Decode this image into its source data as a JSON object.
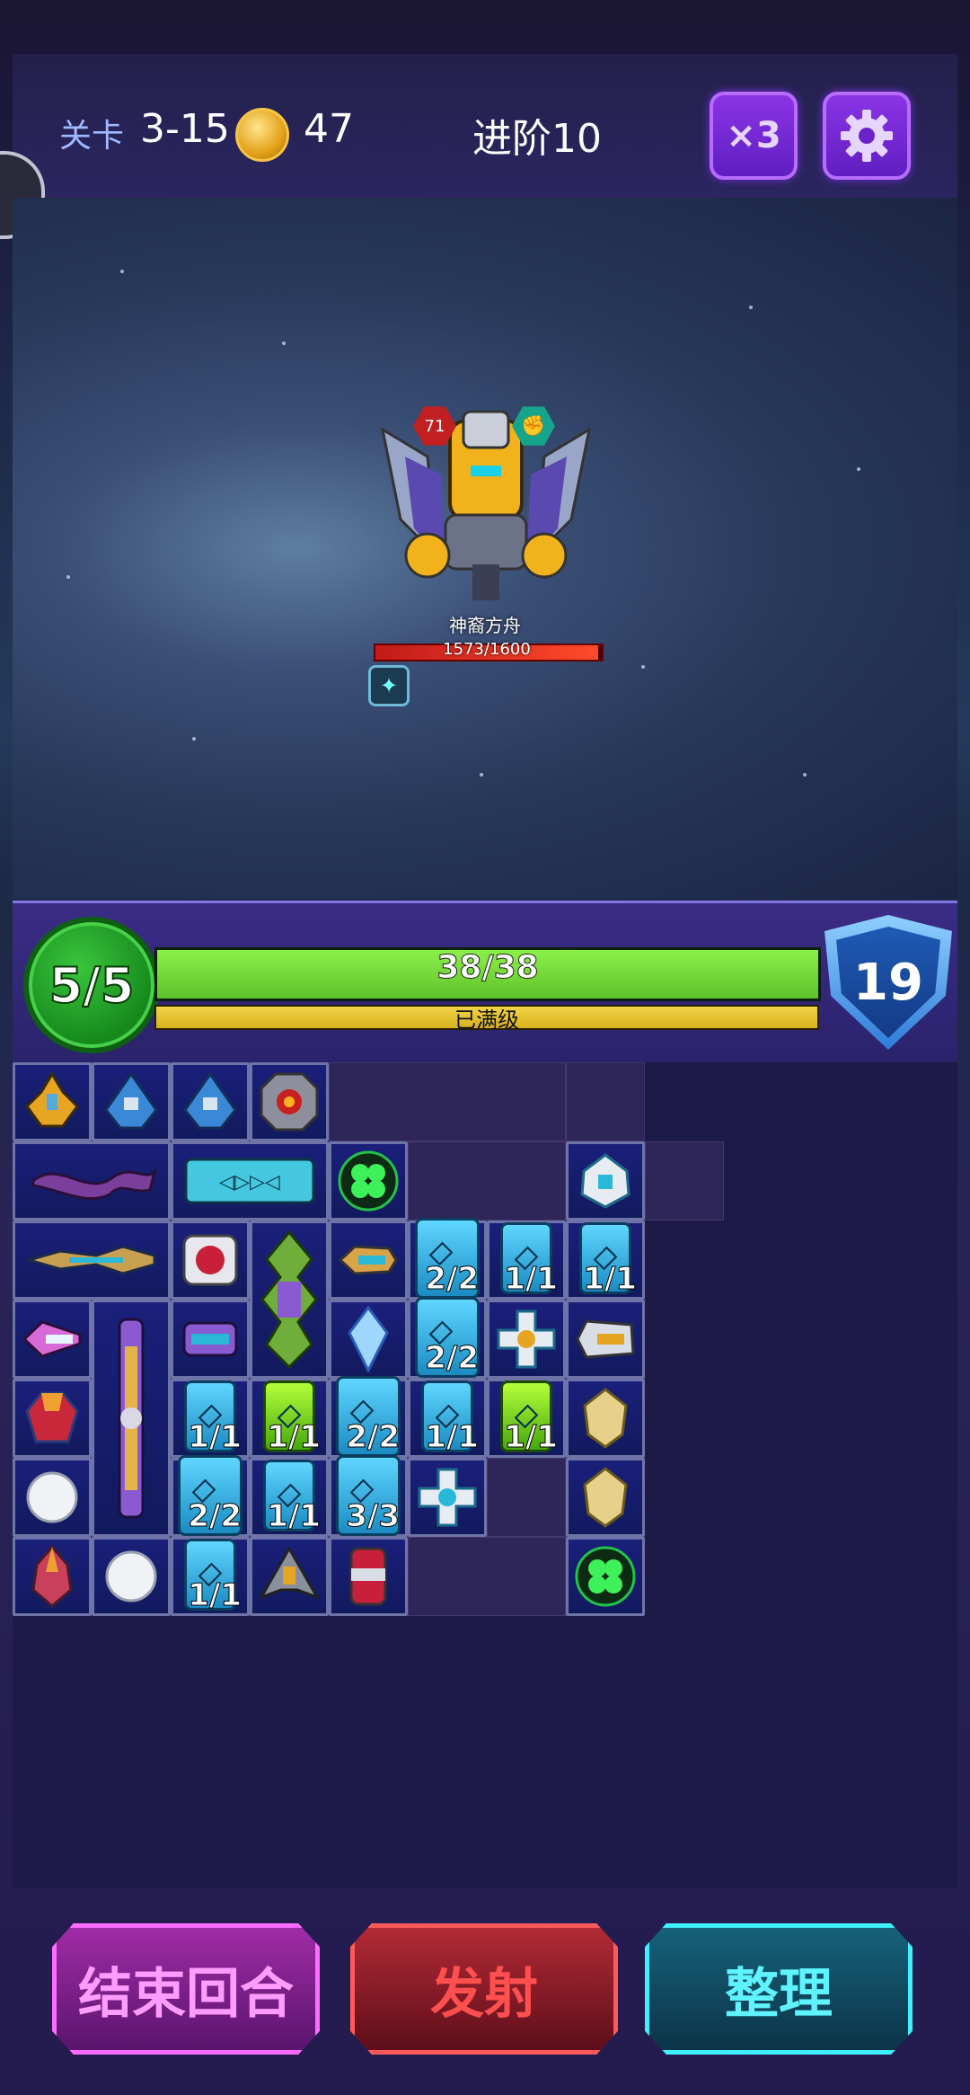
{
  "top_bar": {
    "stage_label": "关卡",
    "stage_value": "3-15",
    "coins": "47",
    "advance": "进阶10",
    "speed": "×3"
  },
  "boss": {
    "name": "神裔方舟",
    "level": "71",
    "hp_text": "1573/1600",
    "hp_fraction": 0.983
  },
  "player": {
    "energy": "5/5",
    "hp_text": "38/38",
    "hp_fraction": 1.0,
    "exp_text": "已满级",
    "exp_fraction": 1.0,
    "shield": "19"
  },
  "inventory": {
    "counts": {
      "c1": "2/2",
      "c2": "1/1",
      "c3": "1/1",
      "c4": "2/2",
      "c5": "1/1",
      "c6": "1/1",
      "c7": "2/2",
      "c8": "1/1",
      "c9": "1/1",
      "c10": "2/2",
      "c11": "1/1",
      "c12": "3/3",
      "c13": "1/1"
    }
  },
  "buttons": {
    "end_turn": "结束回合",
    "fire": "发射",
    "sort": "整理"
  },
  "colors": {
    "end_turn": "#ff6cff",
    "fire": "#ff4f4f",
    "sort": "#3ff0ff"
  }
}
